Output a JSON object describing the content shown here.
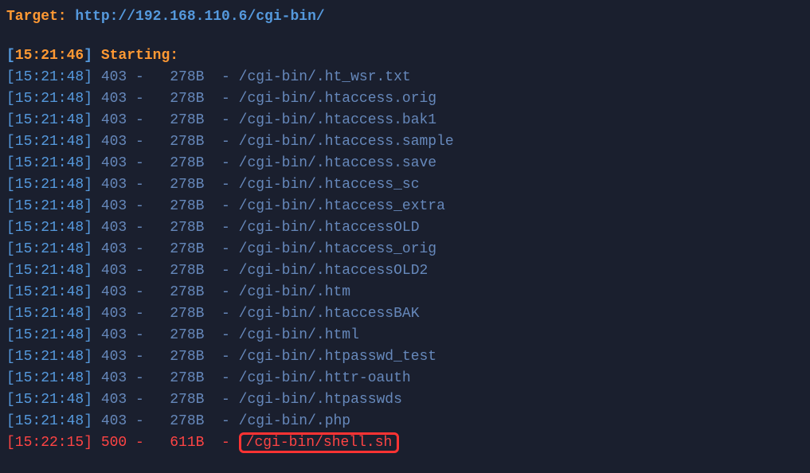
{
  "target": {
    "label": "Target: ",
    "url": "http://192.168.110.6/cgi-bin/"
  },
  "starting": {
    "bracket_open": "[",
    "timestamp": "15:21:46",
    "bracket_close": "]",
    "text": " Starting: "
  },
  "logs": [
    {
      "time": "15:21:48",
      "code": "403",
      "size": "278B",
      "path": "/cgi-bin/.ht_wsr.txt",
      "highlight": false
    },
    {
      "time": "15:21:48",
      "code": "403",
      "size": "278B",
      "path": "/cgi-bin/.htaccess.orig",
      "highlight": false
    },
    {
      "time": "15:21:48",
      "code": "403",
      "size": "278B",
      "path": "/cgi-bin/.htaccess.bak1",
      "highlight": false
    },
    {
      "time": "15:21:48",
      "code": "403",
      "size": "278B",
      "path": "/cgi-bin/.htaccess.sample",
      "highlight": false
    },
    {
      "time": "15:21:48",
      "code": "403",
      "size": "278B",
      "path": "/cgi-bin/.htaccess.save",
      "highlight": false
    },
    {
      "time": "15:21:48",
      "code": "403",
      "size": "278B",
      "path": "/cgi-bin/.htaccess_sc",
      "highlight": false
    },
    {
      "time": "15:21:48",
      "code": "403",
      "size": "278B",
      "path": "/cgi-bin/.htaccess_extra",
      "highlight": false
    },
    {
      "time": "15:21:48",
      "code": "403",
      "size": "278B",
      "path": "/cgi-bin/.htaccessOLD",
      "highlight": false
    },
    {
      "time": "15:21:48",
      "code": "403",
      "size": "278B",
      "path": "/cgi-bin/.htaccess_orig",
      "highlight": false
    },
    {
      "time": "15:21:48",
      "code": "403",
      "size": "278B",
      "path": "/cgi-bin/.htaccessOLD2",
      "highlight": false
    },
    {
      "time": "15:21:48",
      "code": "403",
      "size": "278B",
      "path": "/cgi-bin/.htm",
      "highlight": false
    },
    {
      "time": "15:21:48",
      "code": "403",
      "size": "278B",
      "path": "/cgi-bin/.htaccessBAK",
      "highlight": false
    },
    {
      "time": "15:21:48",
      "code": "403",
      "size": "278B",
      "path": "/cgi-bin/.html",
      "highlight": false
    },
    {
      "time": "15:21:48",
      "code": "403",
      "size": "278B",
      "path": "/cgi-bin/.htpasswd_test",
      "highlight": false
    },
    {
      "time": "15:21:48",
      "code": "403",
      "size": "278B",
      "path": "/cgi-bin/.httr-oauth",
      "highlight": false
    },
    {
      "time": "15:21:48",
      "code": "403",
      "size": "278B",
      "path": "/cgi-bin/.htpasswds",
      "highlight": false
    },
    {
      "time": "15:21:48",
      "code": "403",
      "size": "278B",
      "path": "/cgi-bin/.php",
      "highlight": false
    },
    {
      "time": "15:22:15",
      "code": "500",
      "size": "611B",
      "path": "/cgi-bin/shell.sh",
      "highlight": true
    }
  ]
}
